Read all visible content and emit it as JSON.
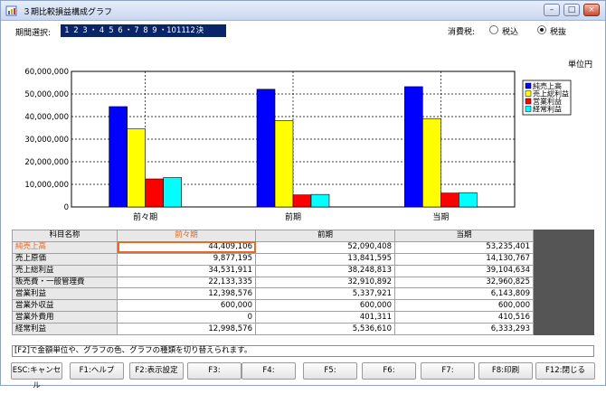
{
  "window": {
    "title": "３期比較損益構成グラフ",
    "controls": [
      "–",
      "□",
      "×"
    ]
  },
  "toolbar": {
    "period_label": "期間選択:",
    "period_values": [
      "1",
      "2",
      "3",
      "・",
      "4",
      "5",
      "6",
      "・",
      "7",
      "8",
      "9",
      "・",
      "10",
      "11",
      "12",
      "決"
    ],
    "tax_label": "消費税:",
    "tax_included": "税込",
    "tax_excluded": "税抜",
    "tax_selected": "税抜"
  },
  "unit_label": "単位円",
  "colors": {
    "series1": "#0000ff",
    "series2": "#ffff00",
    "series3": "#ff0000",
    "series4": "#00ffff",
    "selection": "#e86a2a",
    "period_strip": "#0a246a"
  },
  "chart_data": {
    "type": "bar",
    "categories": [
      "前々期",
      "前期",
      "当期"
    ],
    "series": [
      {
        "name": "純売上高",
        "values": [
          44409106,
          52090408,
          53235401
        ]
      },
      {
        "name": "売上総利益",
        "values": [
          34531911,
          38248813,
          39104634
        ]
      },
      {
        "name": "営業利益",
        "values": [
          12398576,
          5337921,
          6143809
        ]
      },
      {
        "name": "経常利益",
        "values": [
          12998576,
          5536610,
          6333293
        ]
      }
    ],
    "ylim": [
      0,
      60000000
    ],
    "yticks": [
      "0",
      "10,000,000",
      "20,000,000",
      "30,000,000",
      "40,000,000",
      "50,000,000",
      "60,000,000"
    ],
    "grid": true,
    "legend": "top-right"
  },
  "table": {
    "headers": [
      "科目名称",
      "前々期",
      "前期",
      "当期"
    ],
    "rows": [
      {
        "name": "純売上高",
        "values": [
          "44,409,106",
          "52,090,408",
          "53,235,401"
        ]
      },
      {
        "name": "売上原価",
        "values": [
          "9,877,195",
          "13,841,595",
          "14,130,767"
        ]
      },
      {
        "name": "売上総利益",
        "values": [
          "34,531,911",
          "38,248,813",
          "39,104,634"
        ]
      },
      {
        "name": "販売費・一般管理費",
        "values": [
          "22,133,335",
          "32,910,892",
          "32,960,825"
        ]
      },
      {
        "name": "営業利益",
        "values": [
          "12,398,576",
          "5,337,921",
          "6,143,809"
        ]
      },
      {
        "name": "営業外収益",
        "values": [
          "600,000",
          "600,000",
          "600,000"
        ]
      },
      {
        "name": "営業外費用",
        "values": [
          "0",
          "401,311",
          "410,516"
        ]
      },
      {
        "name": "経常利益",
        "values": [
          "12,998,576",
          "5,536,610",
          "6,333,293"
        ]
      }
    ]
  },
  "status_text": "[F2]で金額単位や、グラフの色、グラフの種類を切り替えられます。",
  "fkeys": [
    "ESC:キャンセル",
    "F1:ヘルプ",
    "F2:表示設定",
    "F3:",
    "F4:",
    "F5:",
    "F6:",
    "F7:",
    "F8:印刷",
    "F12:閉じる"
  ]
}
